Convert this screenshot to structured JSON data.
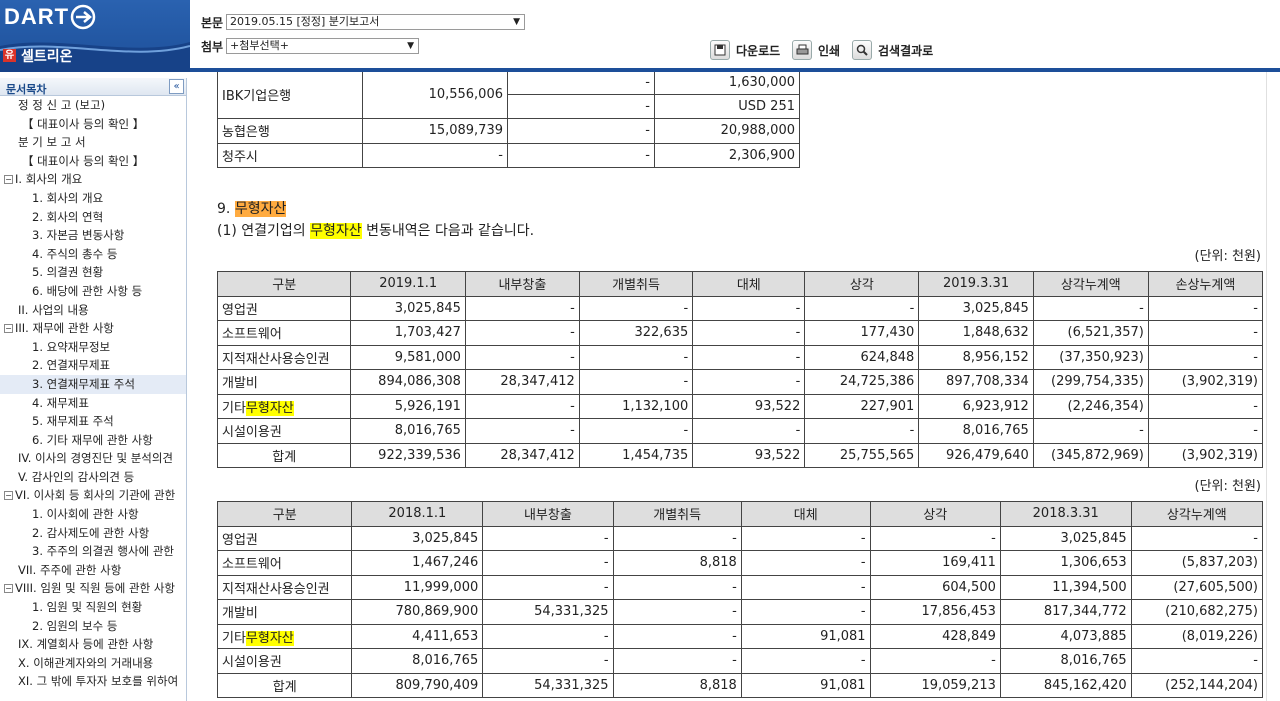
{
  "app": {
    "logo": "DART",
    "company_badge": "유",
    "company_name": "셀트리온"
  },
  "header": {
    "main_label": "본문",
    "main_value": "2019.05.15  [정정] 분기보고서",
    "attach_label": "첨부",
    "attach_value": "+첨부선택+",
    "download_label": "다운로드",
    "print_label": "인쇄",
    "search_result_label": "검색결과로"
  },
  "sidebar": {
    "title": "문서목차",
    "items": [
      {
        "label": "정 정 신 고 (보고)",
        "indent": 1,
        "exp": ""
      },
      {
        "label": "【 대표이사 등의 확인 】",
        "indent": 2,
        "exp": ""
      },
      {
        "label": "분 기 보 고 서",
        "indent": 1,
        "exp": ""
      },
      {
        "label": "【 대표이사 등의 확인 】",
        "indent": 2,
        "exp": ""
      },
      {
        "label": "I. 회사의 개요",
        "indent": 0,
        "exp": "−"
      },
      {
        "label": "1. 회사의 개요",
        "indent": 3,
        "exp": ""
      },
      {
        "label": "2. 회사의 연혁",
        "indent": 3,
        "exp": ""
      },
      {
        "label": "3. 자본금 변동사항",
        "indent": 3,
        "exp": ""
      },
      {
        "label": "4. 주식의 총수 등",
        "indent": 3,
        "exp": ""
      },
      {
        "label": "5. 의결권 현황",
        "indent": 3,
        "exp": ""
      },
      {
        "label": "6. 배당에 관한 사항 등",
        "indent": 3,
        "exp": ""
      },
      {
        "label": "II. 사업의 내용",
        "indent": 1,
        "exp": ""
      },
      {
        "label": "III. 재무에 관한 사항",
        "indent": 0,
        "exp": "−"
      },
      {
        "label": "1. 요약재무정보",
        "indent": 3,
        "exp": ""
      },
      {
        "label": "2. 연결재무제표",
        "indent": 3,
        "exp": ""
      },
      {
        "label": "3. 연결재무제표 주석",
        "indent": 3,
        "exp": "",
        "selected": true
      },
      {
        "label": "4. 재무제표",
        "indent": 3,
        "exp": ""
      },
      {
        "label": "5. 재무제표 주석",
        "indent": 3,
        "exp": ""
      },
      {
        "label": "6. 기타 재무에 관한 사항",
        "indent": 3,
        "exp": ""
      },
      {
        "label": "IV. 이사의 경영진단 및 분석의견",
        "indent": 1,
        "exp": ""
      },
      {
        "label": "V. 감사인의 감사의견 등",
        "indent": 1,
        "exp": ""
      },
      {
        "label": "VI. 이사회 등 회사의 기관에 관한",
        "indent": 0,
        "exp": "−"
      },
      {
        "label": "1. 이사회에 관한 사항",
        "indent": 3,
        "exp": ""
      },
      {
        "label": "2. 감사제도에 관한 사항",
        "indent": 3,
        "exp": ""
      },
      {
        "label": "3. 주주의 의결권 행사에 관한",
        "indent": 3,
        "exp": ""
      },
      {
        "label": "VII. 주주에 관한 사항",
        "indent": 1,
        "exp": ""
      },
      {
        "label": "VIII. 임원 및 직원 등에 관한 사항",
        "indent": 0,
        "exp": "−"
      },
      {
        "label": "1. 임원 및 직원의 현황",
        "indent": 3,
        "exp": ""
      },
      {
        "label": "2. 임원의 보수 등",
        "indent": 3,
        "exp": ""
      },
      {
        "label": "IX. 계열회사 등에 관한 사항",
        "indent": 1,
        "exp": ""
      },
      {
        "label": "X. 이해관계자와의 거래내용",
        "indent": 1,
        "exp": ""
      },
      {
        "label": "XI. 그 밖에 투자자 보호를 위하여",
        "indent": 1,
        "exp": ""
      }
    ]
  },
  "content": {
    "bank_rows": [
      [
        "IBK기업은행",
        "10,556,006",
        "-",
        "1,630,000"
      ],
      [
        "",
        "",
        "-",
        "USD 251"
      ],
      [
        "농협은행",
        "15,089,739",
        "-",
        "20,988,000"
      ],
      [
        "청주시",
        "-",
        "-",
        "2,306,900"
      ]
    ],
    "section_number": "9. ",
    "section_title": "무형자산",
    "sub_prefix": "(1) 연결기업의 ",
    "sub_highlight": "무형자산",
    "sub_suffix": " 변동내역은 다음과 같습니다.",
    "unit_label": "(단위: 천원)",
    "table_2019": {
      "headers": [
        "구분",
        "2019.1.1",
        "내부창출",
        "개별취득",
        "대체",
        "상각",
        "2019.3.31",
        "상각누계액",
        "손상누계액"
      ],
      "rows": [
        [
          "영업권",
          "3,025,845",
          "-",
          "-",
          "-",
          "-",
          "3,025,845",
          "-",
          "-"
        ],
        [
          "소프트웨어",
          "1,703,427",
          "-",
          "322,635",
          "-",
          "177,430",
          "1,848,632",
          "(6,521,357)",
          "-"
        ],
        [
          "지적재산사용승인권",
          "9,581,000",
          "-",
          "-",
          "-",
          "624,848",
          "8,956,152",
          "(37,350,923)",
          "-"
        ],
        [
          "개발비",
          "894,086,308",
          "28,347,412",
          "-",
          "-",
          "24,725,386",
          "897,708,334",
          "(299,754,335)",
          "(3,902,319)"
        ],
        [
          "기타무형자산",
          "5,926,191",
          "-",
          "1,132,100",
          "93,522",
          "227,901",
          "6,923,912",
          "(2,246,354)",
          "-"
        ],
        [
          "시설이용권",
          "8,016,765",
          "-",
          "-",
          "-",
          "-",
          "8,016,765",
          "-",
          "-"
        ],
        [
          "합계",
          "922,339,536",
          "28,347,412",
          "1,454,735",
          "93,522",
          "25,755,565",
          "926,479,640",
          "(345,872,969)",
          "(3,902,319)"
        ]
      ]
    },
    "table_2018": {
      "headers": [
        "구분",
        "2018.1.1",
        "내부창출",
        "개별취득",
        "대체",
        "상각",
        "2018.3.31",
        "상각누계액"
      ],
      "rows": [
        [
          "영업권",
          "3,025,845",
          "-",
          "-",
          "-",
          "-",
          "3,025,845",
          "-"
        ],
        [
          "소프트웨어",
          "1,467,246",
          "-",
          "8,818",
          "-",
          "169,411",
          "1,306,653",
          "(5,837,203)"
        ],
        [
          "지적재산사용승인권",
          "11,999,000",
          "-",
          "-",
          "-",
          "604,500",
          "11,394,500",
          "(27,605,500)"
        ],
        [
          "개발비",
          "780,869,900",
          "54,331,325",
          "-",
          "-",
          "17,856,453",
          "817,344,772",
          "(210,682,275)"
        ],
        [
          "기타무형자산",
          "4,411,653",
          "-",
          "-",
          "91,081",
          "428,849",
          "4,073,885",
          "(8,019,226)"
        ],
        [
          "시설이용권",
          "8,016,765",
          "-",
          "-",
          "-",
          "-",
          "8,016,765",
          "-"
        ],
        [
          "합계",
          "809,790,409",
          "54,331,325",
          "8,818",
          "91,081",
          "19,059,213",
          "845,162,420",
          "(252,144,204)"
        ]
      ]
    },
    "row_label_prefix": "기타",
    "row_label_highlight": "무형자산"
  }
}
